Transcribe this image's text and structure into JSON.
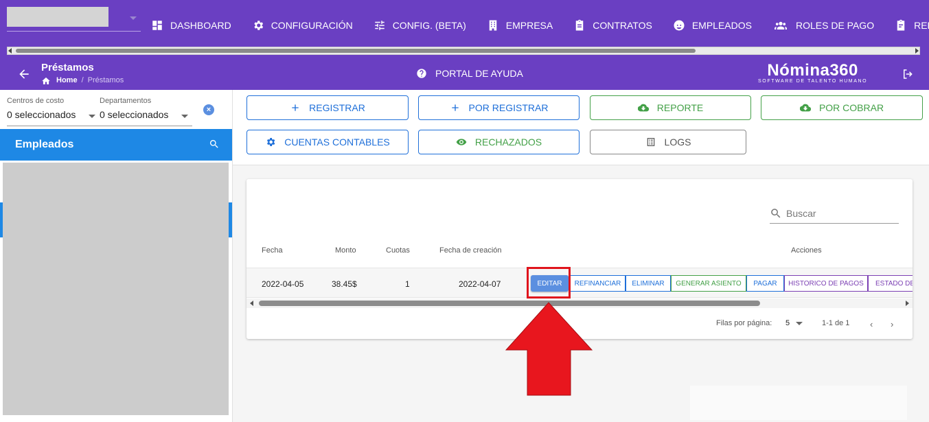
{
  "topnav": {
    "items": [
      {
        "label": "DASHBOARD",
        "icon": "dashboard-icon"
      },
      {
        "label": "CONFIGURACIÓN",
        "icon": "gear-icon"
      },
      {
        "label": "CONFIG. (BETA)",
        "icon": "sliders-icon"
      },
      {
        "label": "EMPRESA",
        "icon": "building-icon"
      },
      {
        "label": "CONTRATOS",
        "icon": "clipboard-icon"
      },
      {
        "label": "EMPLEADOS",
        "icon": "face-icon"
      },
      {
        "label": "ROLES DE PAGO",
        "icon": "people-icon"
      },
      {
        "label": "REPORTES",
        "icon": "report-icon"
      }
    ]
  },
  "subheader": {
    "title": "Préstamos",
    "breadcrumb_home": "Home",
    "breadcrumb_current": "Préstamos",
    "help_label": "PORTAL DE AYUDA",
    "brand_name": "Nómina360",
    "brand_tagline": "SOFTWARE DE TALENTO HUMANO"
  },
  "filters": {
    "cost_centers_label": "Centros de costo",
    "cost_centers_value": "0 seleccionados",
    "departments_label": "Departamentos",
    "departments_value": "0 seleccionados"
  },
  "employees": {
    "title": "Empleados"
  },
  "actions": {
    "registrar": "REGISTRAR",
    "por_registrar": "POR REGISTRAR",
    "reporte": "REPORTE",
    "por_cobrar": "POR COBRAR",
    "cuentas_contables": "CUENTAS CONTABLES",
    "rechazados": "RECHAZADOS",
    "logs": "LOGS"
  },
  "table": {
    "search_placeholder": "Buscar",
    "headers": {
      "fecha": "Fecha",
      "monto": "Monto",
      "cuotas": "Cuotas",
      "fecha_creacion": "Fecha de creación",
      "acciones": "Acciones"
    },
    "rows": [
      {
        "fecha": "2022-04-05",
        "monto": "38.45$",
        "cuotas": "1",
        "fecha_creacion": "2022-04-07",
        "buttons": {
          "editar": "EDITAR",
          "refinanciar": "REFINANCIAR",
          "eliminar": "ELIMINAR",
          "generar_asiento": "GENERAR ASIENTO",
          "pagar": "PAGAR",
          "historico": "HISTORICO DE PAGOS",
          "estado": "ESTADO DE"
        }
      }
    ],
    "pagination": {
      "rows_per_page_label": "Filas por página:",
      "rows_per_page": "5",
      "range": "1-1 de 1"
    }
  },
  "colors": {
    "header_purple": "#6a3fc2",
    "primary_blue": "#1e88e5",
    "action_green": "#43a047",
    "highlight_red": "#e0141c"
  }
}
